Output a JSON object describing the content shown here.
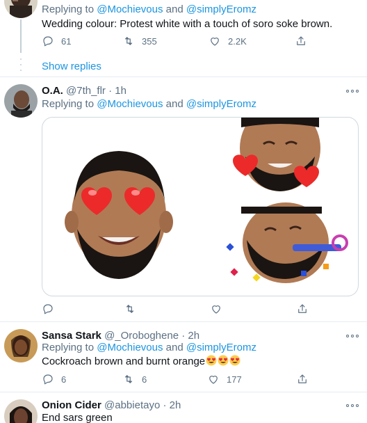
{
  "tweets": [
    {
      "reply_prefix": "Replying to",
      "mentions": [
        "@Mochievous",
        "and",
        "@simplyEromz"
      ],
      "text": "Wedding colour: Protest white with a touch of soro soke brown.",
      "replies": "61",
      "retweets": "355",
      "likes": "2.2K"
    },
    {
      "name": "O.A.",
      "handle": "@7th_flr",
      "time": "· 1h",
      "reply_prefix": "Replying to",
      "mentions": [
        "@Mochievous",
        "and",
        "@simplyEromz"
      ]
    },
    {
      "name": "Sansa Stark",
      "handle": "@_Oroboghene",
      "time": "· 2h",
      "reply_prefix": "Replying to",
      "mentions": [
        "@Mochievous",
        "and",
        "@simplyEromz"
      ],
      "text": "Cockroach brown and burnt orange",
      "replies": "6",
      "retweets": "6",
      "likes": "177"
    },
    {
      "name": "Onion Cider",
      "handle": "@abbietayo",
      "time": "· 2h",
      "text": "End sars green"
    }
  ],
  "show_replies": "Show replies",
  "colors": {
    "accent": "#1b95e0",
    "muted": "#5b7083",
    "border": "#e6ecf0"
  }
}
